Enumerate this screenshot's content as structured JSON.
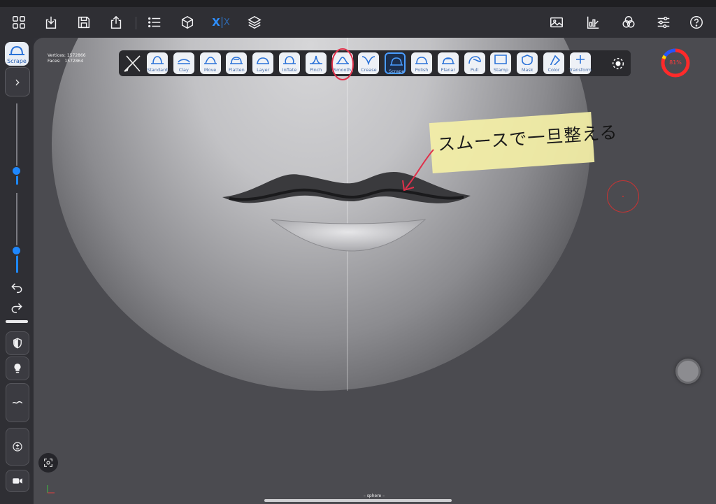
{
  "top_toolbar": {
    "left_icons": [
      "grid-icon",
      "import-icon",
      "save-icon",
      "share-icon",
      "list-icon",
      "cube-icon",
      "symmetry-icon",
      "layers-icon"
    ],
    "symmetry_label": "X",
    "right_icons": [
      "image-icon",
      "chart-icon",
      "color-circles-icon",
      "sliders-icon",
      "help-icon"
    ]
  },
  "left_sidebar": {
    "active_tool_label": "Scrape",
    "radius_slider_value": 0.5,
    "intensity_slider_value": 0.3,
    "icons": [
      "chevron-right-icon",
      "undo-icon",
      "redo-icon",
      "shield-icon",
      "bulb-icon",
      "stroke-icon",
      "plus-minus-icon",
      "camera-icon"
    ]
  },
  "tool_strip": {
    "tools": [
      {
        "label": "Standard",
        "selected": false
      },
      {
        "label": "Clay",
        "selected": false
      },
      {
        "label": "Move",
        "selected": false
      },
      {
        "label": "Flatten",
        "selected": false
      },
      {
        "label": "Layer",
        "selected": false
      },
      {
        "label": "Inflate",
        "selected": false
      },
      {
        "label": "Pinch",
        "selected": false
      },
      {
        "label": "Smooth",
        "selected": false
      },
      {
        "label": "Crease",
        "selected": false
      },
      {
        "label": "Scrape",
        "selected": true
      },
      {
        "label": "Polish",
        "selected": false
      },
      {
        "label": "Planar",
        "selected": false
      },
      {
        "label": "Pull",
        "selected": false
      },
      {
        "label": "Stamp",
        "selected": false
      },
      {
        "label": "Mask",
        "selected": false
      },
      {
        "label": "Color",
        "selected": false
      },
      {
        "label": "Transform",
        "selected": false
      }
    ]
  },
  "mesh_info": {
    "vertices_label": "Vertices:",
    "vertices": "1572866",
    "faces_label": "Faces:",
    "faces": "1572864"
  },
  "gauge": {
    "percent": 0.81,
    "text": "81%",
    "color": "#ff2a2a"
  },
  "annotation": {
    "text": "スムースで一旦整える",
    "highlight_color": "#f5f0a7",
    "pen_color": "#e0304a"
  },
  "mesh_name": "– sphere –",
  "colors": {
    "accent": "#1e88ff",
    "toolbar": "#2f2f34",
    "viewport": "#4b4b50"
  }
}
